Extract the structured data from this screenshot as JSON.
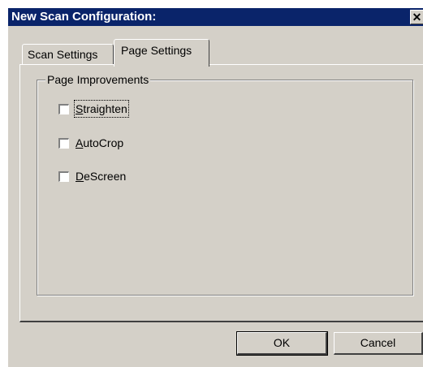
{
  "window": {
    "title": "New Scan Configuration:",
    "close_glyph": "✕"
  },
  "tabs": [
    {
      "label": "Scan Settings",
      "active": false
    },
    {
      "label": "Page Settings",
      "active": true
    }
  ],
  "group": {
    "legend": "Page Improvements",
    "options": [
      {
        "label": "Straighten",
        "checked": false,
        "focused": true
      },
      {
        "label": "AutoCrop",
        "checked": false,
        "focused": false
      },
      {
        "label": "DeScreen",
        "checked": false,
        "focused": false
      }
    ]
  },
  "buttons": {
    "ok": "OK",
    "cancel": "Cancel"
  },
  "colors": {
    "titlebar": "#0a246a",
    "face": "#d4d0c8"
  }
}
